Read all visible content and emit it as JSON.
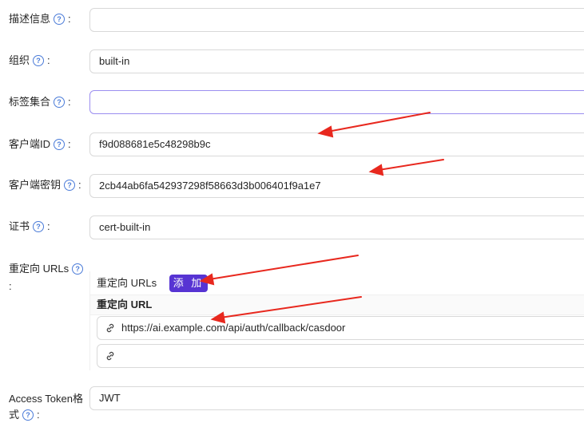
{
  "fields": {
    "description": {
      "label": "描述信息",
      "colon": ":",
      "value": ""
    },
    "organization": {
      "label": "组织",
      "colon": ":",
      "value": "built-in"
    },
    "tags": {
      "label": "标签集合",
      "colon": ":",
      "value": ""
    },
    "client_id": {
      "label": "客户端ID",
      "colon": ":",
      "value": "f9d088681e5c48298b9c"
    },
    "client_secret": {
      "label": "客户端密钥",
      "colon": ":",
      "value": "2cb44ab6fa542937298f58663d3b006401f9a1e7"
    },
    "cert": {
      "label": "证书",
      "colon": ":",
      "value": "cert-built-in"
    },
    "redirect_urls": {
      "label": "重定向 URLs",
      "colon": ":",
      "section_title": "重定向 URLs",
      "add_label": "添 加",
      "column_header": "重定向 URL",
      "rows": [
        "https://ai.example.com/api/auth/callback/casdoor",
        ""
      ]
    },
    "access_token_format": {
      "label_line1": "Access Token格",
      "label_line2": "式",
      "colon": ":",
      "value": "JWT"
    }
  },
  "icons": {
    "help": "question-circle-icon",
    "link": "link-icon"
  },
  "colors": {
    "accent": "#5734d3",
    "help": "#4a7bd8",
    "arrow": "#e8281e"
  }
}
